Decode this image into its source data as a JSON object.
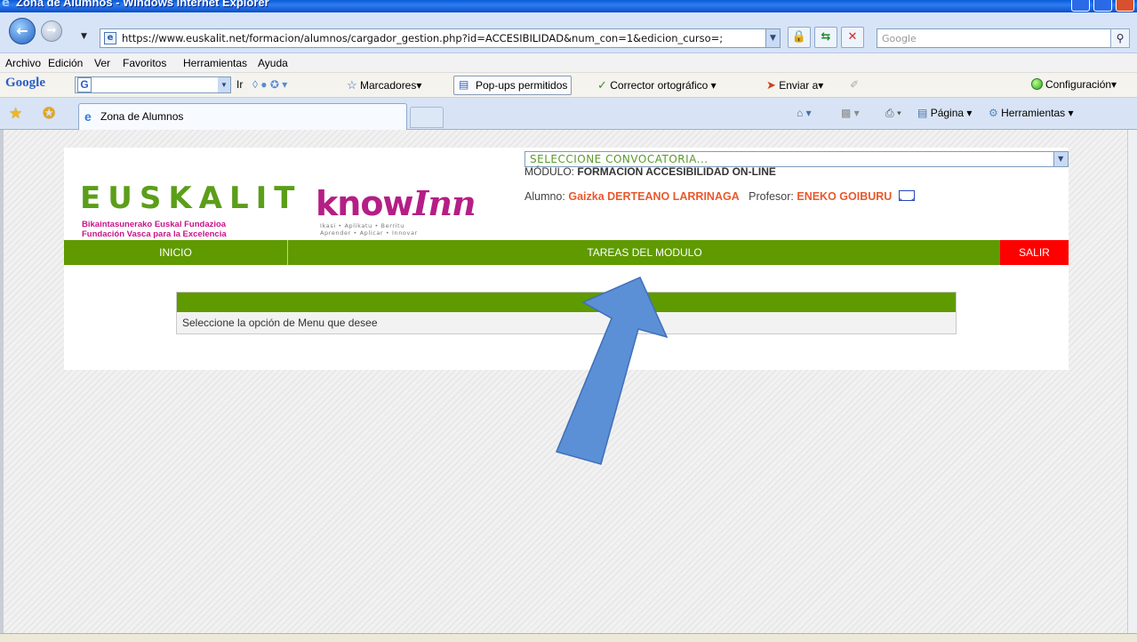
{
  "window": {
    "title": "Zona de Alumnos - Windows Internet Explorer"
  },
  "address_bar": {
    "url": "https://www.euskalit.net/formacion/alumnos/cargador_gestion.php?id=ACCESIBILIDAD&num_con=1&edicion_curso=;",
    "search_placeholder": "Google"
  },
  "menu": {
    "items": [
      "Archivo",
      "Edición",
      "Ver",
      "Favoritos",
      "Herramientas",
      "Ayuda"
    ]
  },
  "google_toolbar": {
    "logo": "Google",
    "go_label": "Ir",
    "bookmarks_label": "Marcadores",
    "popups_label": "Pop-ups permitidos",
    "spell_label": "Corrector ortográfico",
    "send_label": "Enviar a",
    "settings_label": "Configuración"
  },
  "tabs": {
    "active_tab": "Zona de Alumnos",
    "page_label": "Página",
    "tools_label": "Herramientas"
  },
  "page": {
    "logo_euskalit": "EUSKALIT",
    "logo_sub1": "Bikaintasunerako Euskal Fundazioa",
    "logo_sub2": "Fundación Vasca para la Excelencia",
    "logo_knowinn_a": "know",
    "logo_knowinn_b": "Inn",
    "knowinn_sub1": "Ikasi • Aplikatu • Berritu",
    "knowinn_sub2": "Aprender • Aplicar • Innovar",
    "convocatoria_select": "SELECCIONE CONVOCATORIA...",
    "modulo_label": "MÓDULO:",
    "modulo_value": "FORMACION ACCESIBILIDAD ON-LINE",
    "alumno_label": "Alumno:",
    "alumno_value": "Gaizka DERTEANO LARRINAGA",
    "profesor_label": "Profesor:",
    "profesor_value": "ENEKO GOIBURU",
    "nav": {
      "inicio": "INICIO",
      "tareas": "TAREAS DEL MODULO",
      "salir": "SALIR"
    },
    "message": "Seleccione la opción de Menu que desee"
  },
  "colors": {
    "nav_green": "#5f9a00",
    "salir_red": "#ff0000",
    "highlight_orange": "#e8592d",
    "arrow_blue": "#5b8fd6"
  }
}
